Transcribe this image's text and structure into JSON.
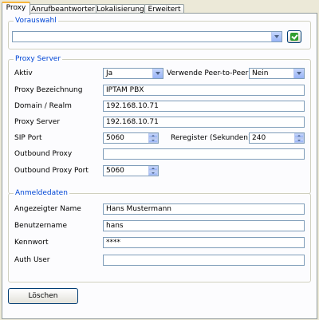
{
  "tabs": [
    "Proxy",
    "Anrufbeantworter",
    "Lokalisierung",
    "Erweitert"
  ],
  "vorauswahl": {
    "legend": "Vorauswahl",
    "value": ""
  },
  "proxy_server": {
    "legend": "Proxy Server",
    "aktiv": {
      "label": "Aktiv",
      "value": "Ja"
    },
    "p2p": {
      "label": "Verwende Peer-to-Peer",
      "value": "Nein"
    },
    "bezeichnung": {
      "label": "Proxy Bezeichnung",
      "value": "IPTAM PBX"
    },
    "domain": {
      "label": "Domain / Realm",
      "value": "192.168.10.71"
    },
    "server": {
      "label": "Proxy Server",
      "value": "192.168.10.71"
    },
    "sip_port": {
      "label": "SIP Port",
      "value": "5060"
    },
    "reregister": {
      "label": "Reregister (Sekunden)",
      "value": "240"
    },
    "outbound": {
      "label": "Outbound Proxy",
      "value": ""
    },
    "outbound_port": {
      "label": "Outbound Proxy Port",
      "value": "5060"
    }
  },
  "anmeldedaten": {
    "legend": "Anmeldedaten",
    "name": {
      "label": "Angezeigter Name",
      "value": "Hans Mustermann"
    },
    "user": {
      "label": "Benutzername",
      "value": "hans"
    },
    "pass": {
      "label": "Kennwort",
      "value": "****"
    },
    "auth": {
      "label": "Auth User",
      "value": ""
    }
  },
  "delete_label": "Löschen"
}
